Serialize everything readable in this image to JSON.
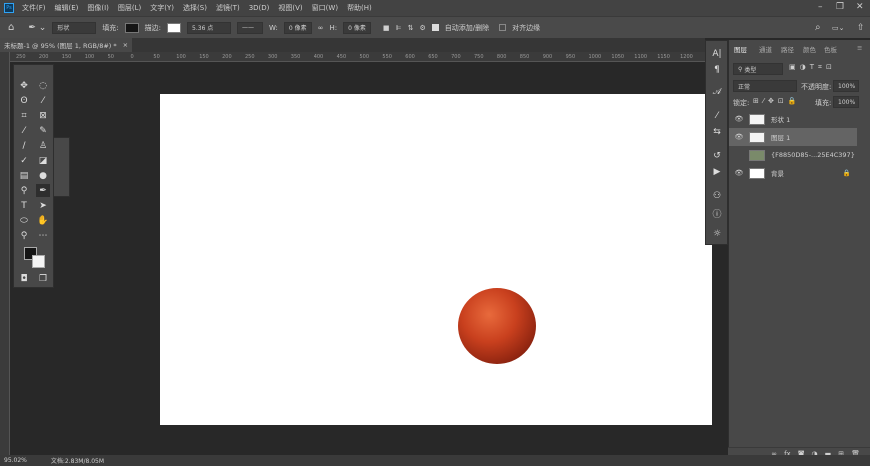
{
  "app": {
    "logo": "Ps"
  },
  "menu": [
    "文件(F)",
    "编辑(E)",
    "图像(I)",
    "图层(L)",
    "文字(Y)",
    "选择(S)",
    "滤镜(T)",
    "3D(D)",
    "视图(V)",
    "窗口(W)",
    "帮助(H)"
  ],
  "options": {
    "mode": "形状",
    "fill_label": "填充:",
    "stroke_label": "描边:",
    "stroke_width": "5.36 点",
    "w_label": "W:",
    "w_value": "0 像素",
    "h_label": "H:",
    "h_value": "0 像素",
    "auto_add_delete": "自动添加/删除",
    "auto_checked": true,
    "align_edges": "对齐边缘",
    "fill_color": "#151515"
  },
  "document": {
    "tab_title": "未标题-1 @ 95% (图层 1, RGB/8#) *",
    "close": "×"
  },
  "ruler": [
    "250",
    "200",
    "150",
    "100",
    "50",
    "0",
    "50",
    "100",
    "150",
    "200",
    "250",
    "300",
    "350",
    "400",
    "450",
    "500",
    "550",
    "600",
    "650",
    "700",
    "750",
    "800",
    "850",
    "900",
    "950",
    "1000",
    "1050",
    "1100",
    "1150",
    "1200"
  ],
  "layers_panel": {
    "tabs": [
      "图层",
      "通道",
      "路径",
      "颜色",
      "色板"
    ],
    "filter": "类型",
    "blend_mode": "正常",
    "opacity_label": "不透明度:",
    "opacity": "100%",
    "lock_label": "锁定:",
    "fill_label": "填充:",
    "fill": "100%",
    "layers": [
      {
        "name": "形状 1",
        "visible": true
      },
      {
        "name": "图层 1",
        "visible": true,
        "selected": true
      },
      {
        "name": "{F8850D85-...25E4C397}",
        "visible": false
      },
      {
        "name": "背景",
        "visible": true,
        "locked": true
      }
    ]
  },
  "status": {
    "zoom": "95.02%",
    "doc": "文档:2.83M/8.05M"
  },
  "colors": {
    "accent": "#2fa3f5",
    "foreground": "#151515",
    "background": "#f4f4f4"
  }
}
